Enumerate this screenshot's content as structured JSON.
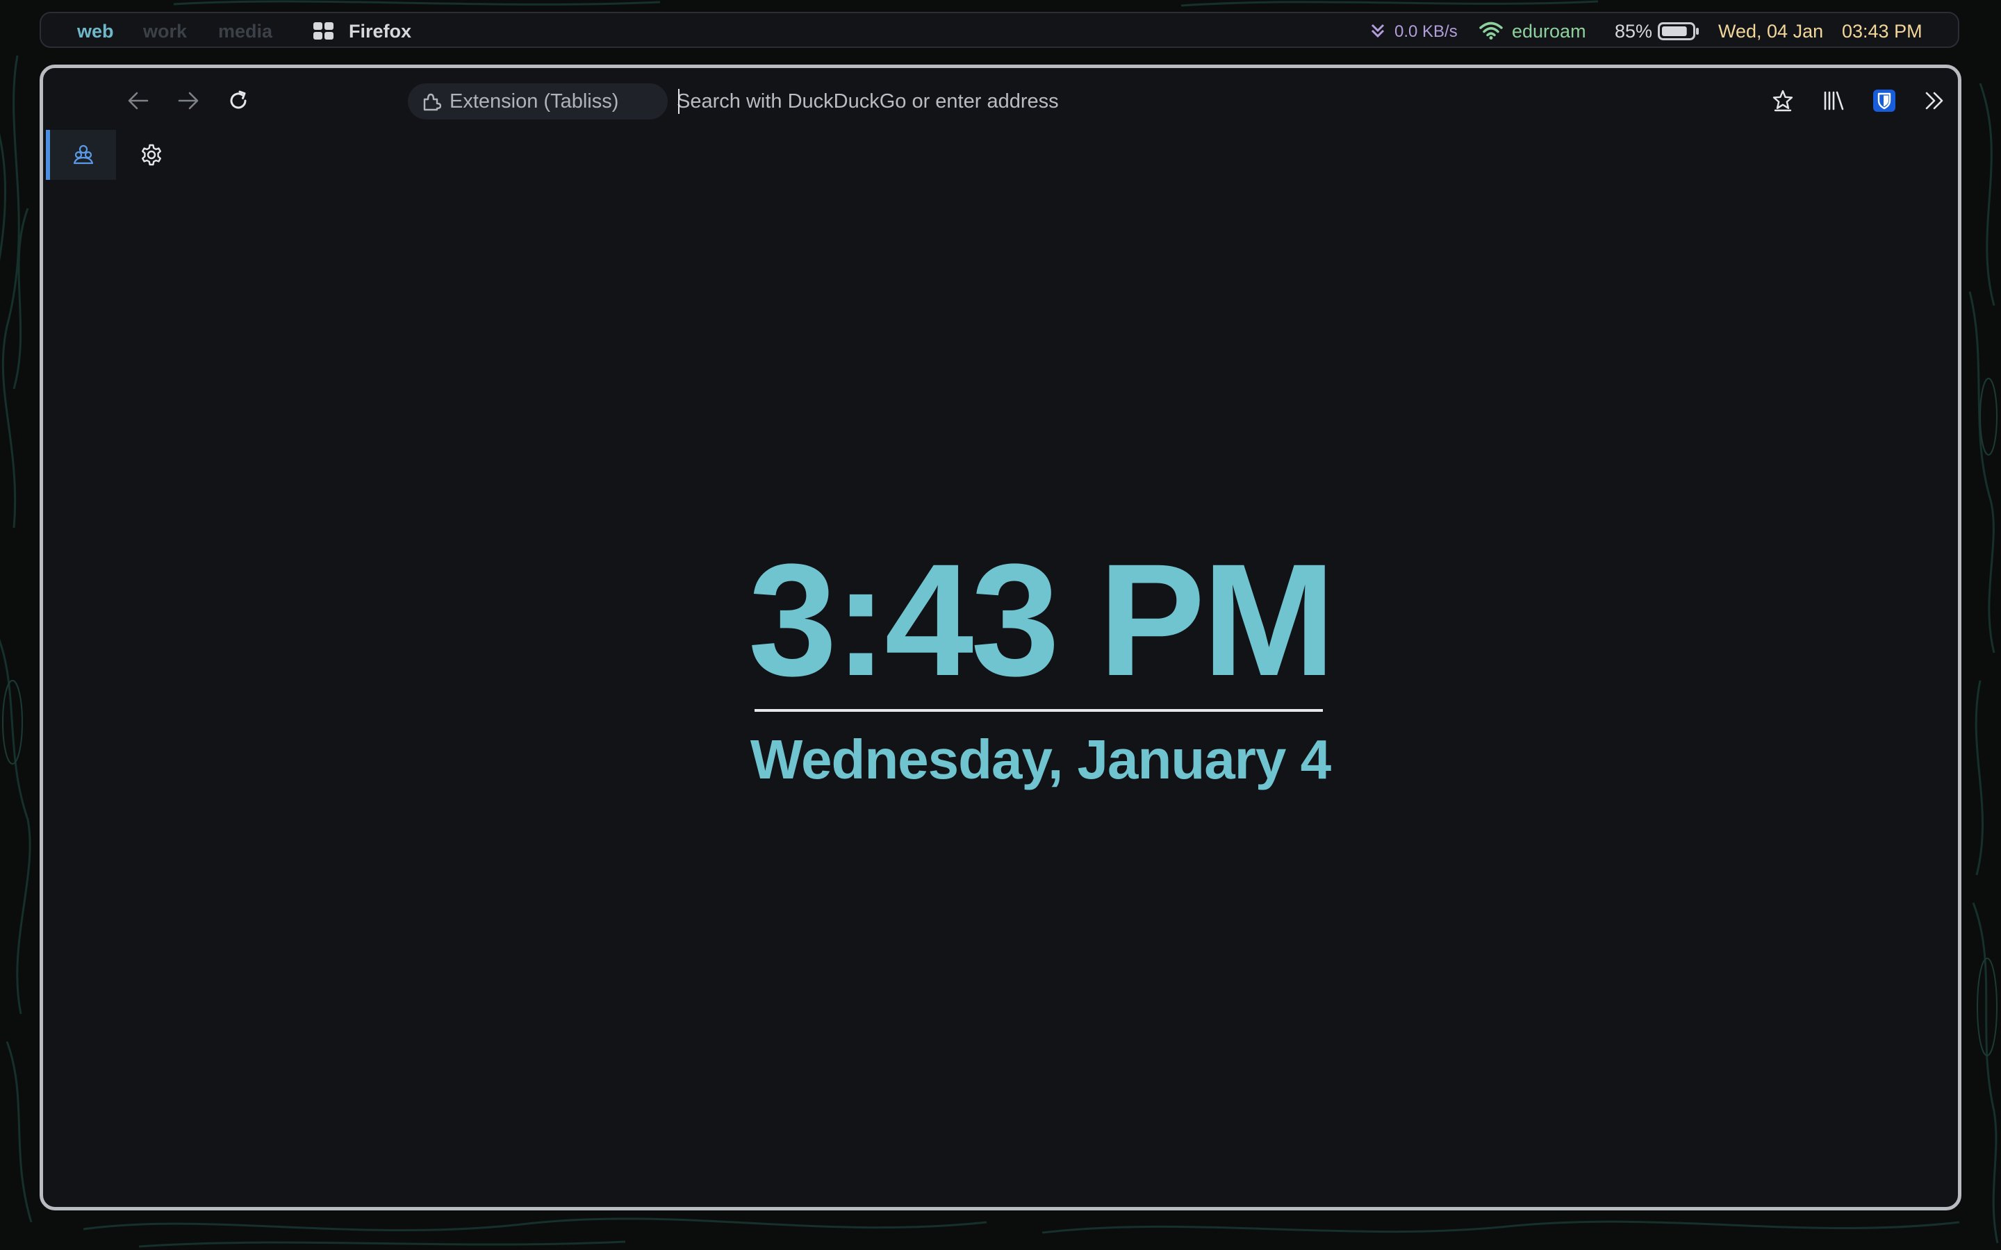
{
  "topbar": {
    "workspaces": [
      "web",
      "work",
      "media"
    ],
    "active_workspace": "web",
    "app_icon": "windows-grid-icon",
    "app_name": "Firefox",
    "net_icon": "download-arrows-icon",
    "net_speed": "0.0 KB/s",
    "wifi_icon": "wifi-icon",
    "wifi_name": "eduroam",
    "battery_percent": "85%",
    "battery_level": 0.85,
    "battery_icon": "battery-icon",
    "date": "Wed, 04 Jan",
    "time": "03:43 PM"
  },
  "browser": {
    "nav": {
      "back_icon": "arrow-left-icon",
      "forward_icon": "arrow-right-icon",
      "reload_icon": "reload-icon"
    },
    "identity_label": "Extension (Tabliss)",
    "identity_icon": "puzzle-piece-icon",
    "url_placeholder": "Search with DuckDuckGo or enter address",
    "url_value": "",
    "toolbar_icons": [
      "bookmark-star-icon",
      "library-icon",
      "bitwarden-shield-icon",
      "overflow-chevrons-icon"
    ],
    "sidebar_icons": [
      "container-tab-icon",
      "settings-gear-icon"
    ]
  },
  "tabliss": {
    "time": "3:43 PM",
    "date": "Wednesday, January 4"
  },
  "colors": {
    "accent": "#6fc4cf",
    "workspace_active": "#6fb8c9",
    "workspace_inactive": "#3c4148",
    "net": "#b39ddb",
    "wifi": "#8fd19e",
    "clock": "#f2d69a",
    "window_bg": "#111317",
    "window_border": "#b8bcc1",
    "bitwarden": "#175ddc"
  }
}
